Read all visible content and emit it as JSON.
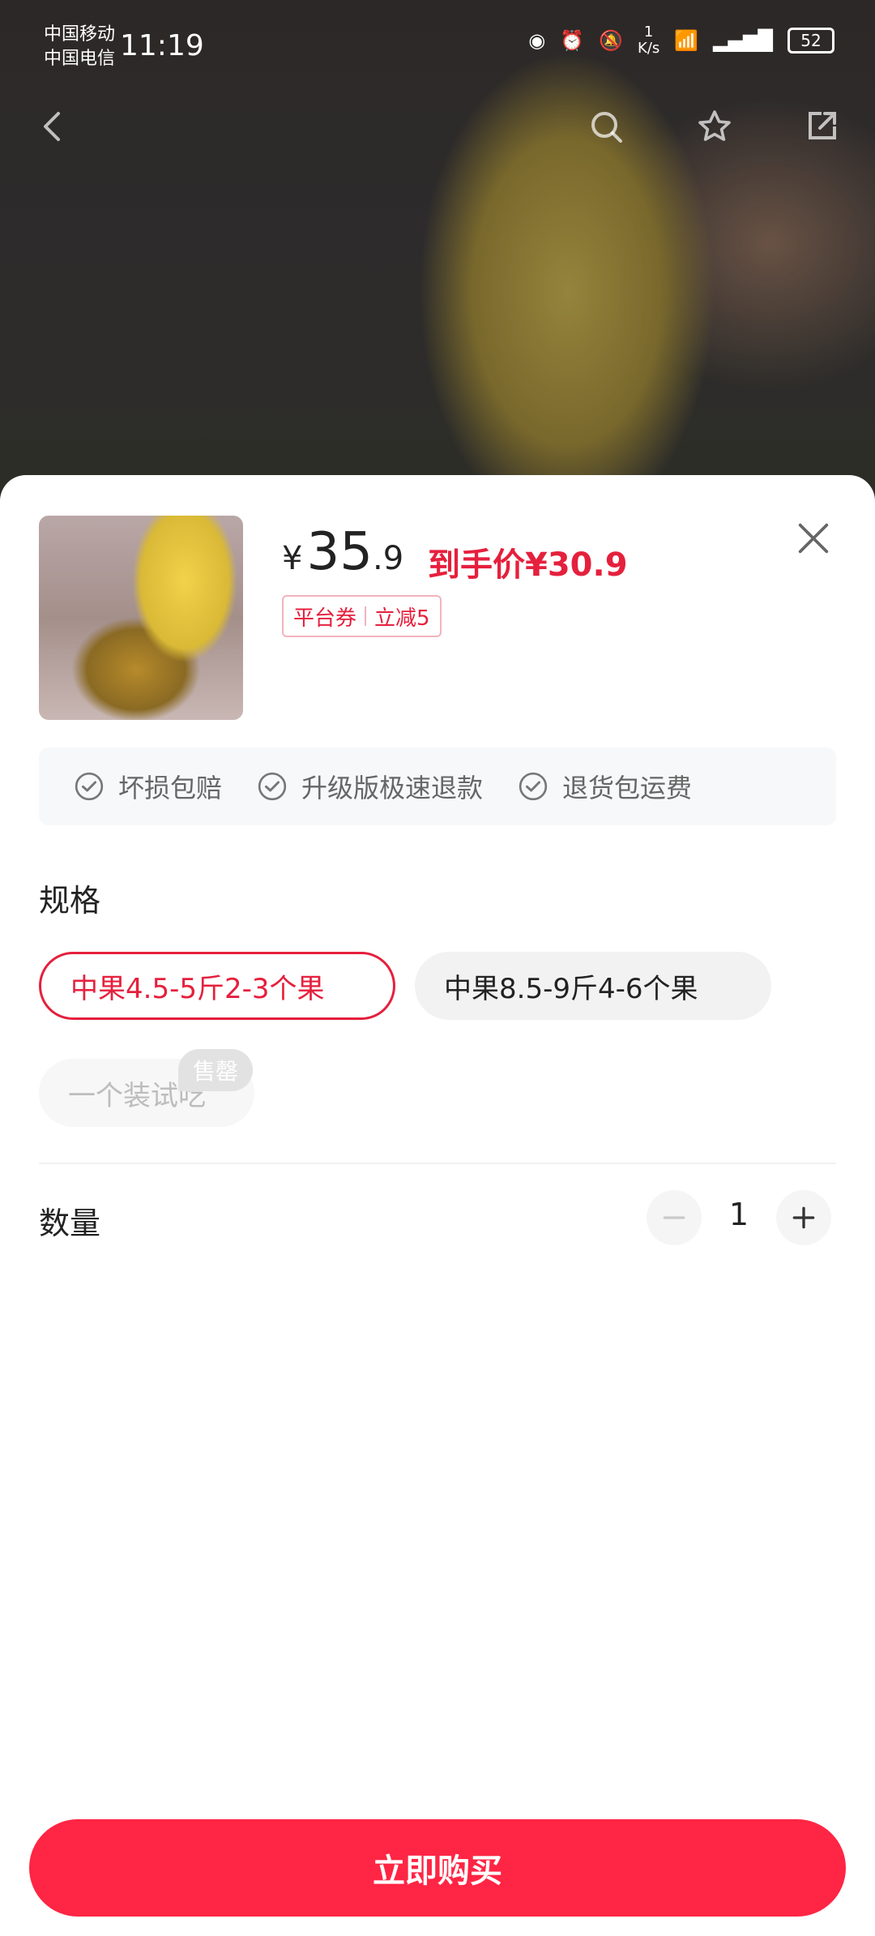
{
  "status": {
    "carrier1": "中国移动",
    "carrier2": "中国电信",
    "time": "11:19",
    "net_speed": "1\nK/s",
    "battery": "52"
  },
  "product": {
    "price_yen": "¥",
    "price_int": "35",
    "price_dec": ".9",
    "final_label": "到手价¥30.9",
    "coupon": {
      "left": "平台券",
      "right": "立减5"
    }
  },
  "guarantees": [
    "坏损包赔",
    "升级版极速退款",
    "退货包运费"
  ],
  "spec": {
    "title": "规格",
    "options": [
      "中果4.5-5斤2-3个果",
      "中果8.5-9斤4-6个果",
      "一个装试吃"
    ],
    "soldout": "售罄"
  },
  "quantity": {
    "title": "数量",
    "value": "1",
    "minus": "−",
    "plus": "+"
  },
  "buy_button": "立即购买",
  "colors": {
    "accent": "#e5203d",
    "buy": "#ff2544"
  },
  "icons": [
    "back-icon",
    "search-icon",
    "star-icon",
    "share-icon",
    "close-icon",
    "check-circle-icon"
  ]
}
